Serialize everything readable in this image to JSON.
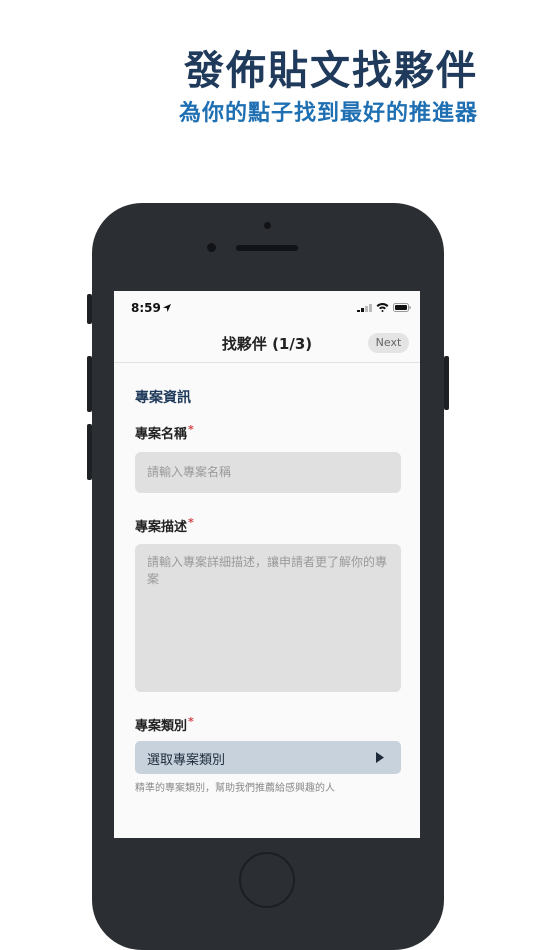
{
  "promo": {
    "title": "發佈貼文找夥伴",
    "subtitle": "為你的點子找到最好的推進器"
  },
  "status_bar": {
    "time": "8:59",
    "icons": [
      "location-arrow-icon",
      "signal-icon",
      "wifi-icon",
      "battery-icon"
    ]
  },
  "nav": {
    "title": "找夥伴 (1/3)",
    "next_label": "Next"
  },
  "form": {
    "section_title": "專案資訊",
    "name_label": "專案名稱",
    "name_placeholder": "請輸入專案名稱",
    "desc_label": "專案描述",
    "desc_placeholder": "請輸入專案詳細描述，讓申請者更了解你的專案",
    "category_label": "專案類別",
    "category_value": "選取專案類別",
    "category_hint": "精準的專案類別，幫助我們推薦給感興趣的人",
    "required_mark": "*"
  },
  "colors": {
    "title": "#1f3a5a",
    "subtitle": "#1f6fb3",
    "required": "#d0434a",
    "select_bg": "#c7d2dd"
  }
}
